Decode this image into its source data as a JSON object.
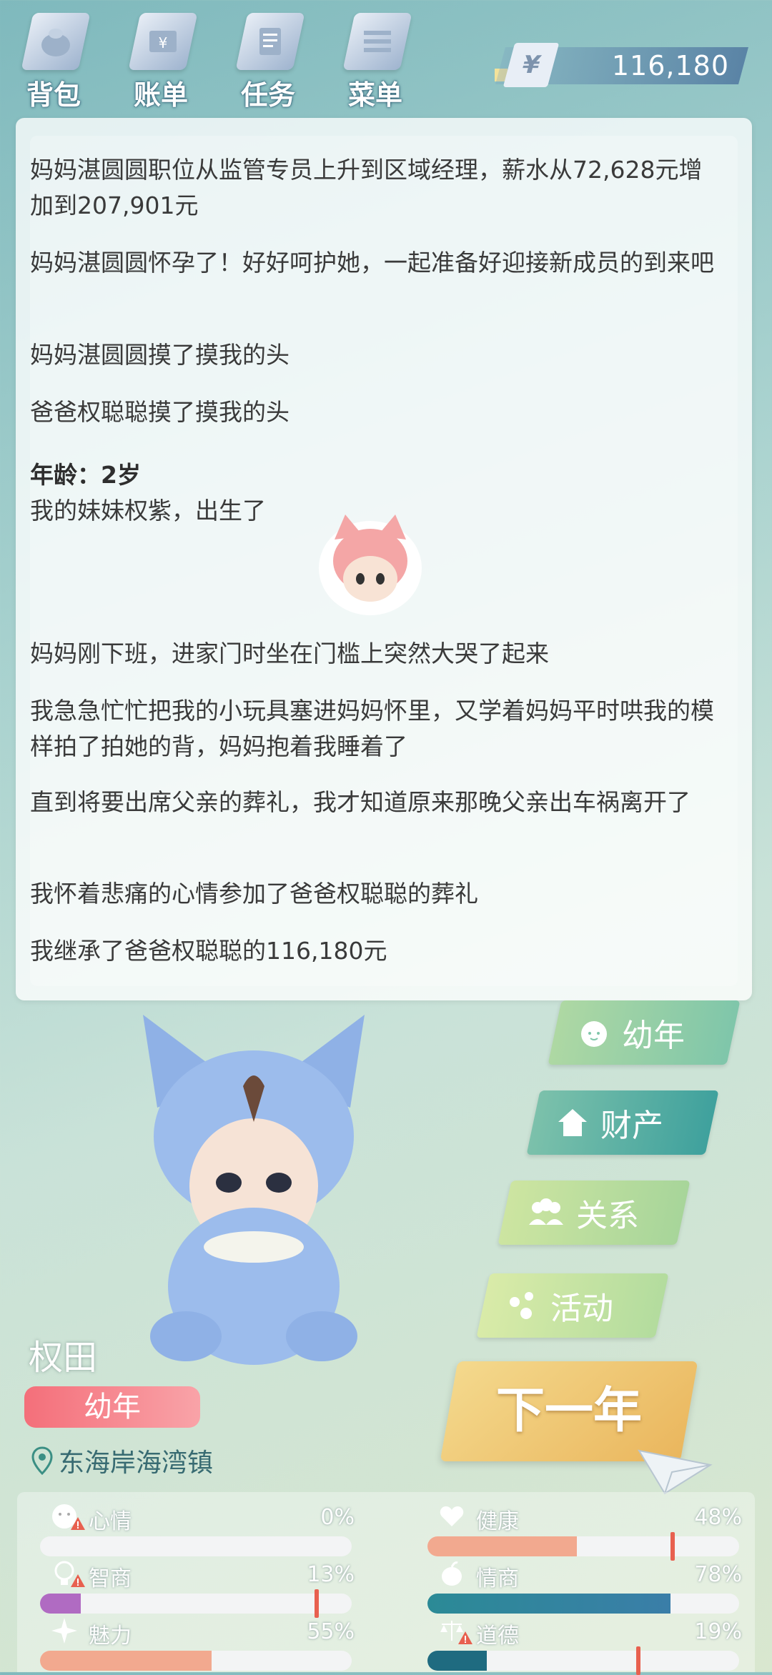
{
  "top_menu": [
    {
      "label": "背包",
      "icon": "bag-icon"
    },
    {
      "label": "账单",
      "icon": "bill-icon"
    },
    {
      "label": "任务",
      "icon": "task-icon"
    },
    {
      "label": "菜单",
      "icon": "menu-icon"
    }
  ],
  "money": {
    "symbol": "¥",
    "amount": "116,180"
  },
  "story": {
    "paragraphs_before": [
      "妈妈湛圆圆职位从监管专员上升到区域经理，薪水从72,628元增加到207,901元",
      "妈妈湛圆圆怀孕了！好好呵护她，一起准备好迎接新成员的到来吧",
      "妈妈湛圆圆摸了摸我的头",
      "爸爸权聪聪摸了摸我的头"
    ],
    "age_heading": "年龄：2岁",
    "sister_line": "我的妹妹权紫，出生了",
    "paragraphs_after": [
      "妈妈刚下班，进家门时坐在门槛上突然大哭了起来",
      "我急急忙忙把我的小玩具塞进妈妈怀里，又学着妈妈平时哄我的模样拍了拍她的背，妈妈抱着我睡着了",
      "直到将要出席父亲的葬礼，我才知道原来那晚父亲出车祸离开了",
      "我怀着悲痛的心情参加了爸爸权聪聪的葬礼",
      "我继承了爸爸权聪聪的116,180元"
    ]
  },
  "side_menu": {
    "stage": "幼年",
    "property": "财产",
    "relations": "关系",
    "activities": "活动"
  },
  "next_year": "下一年",
  "character": {
    "name": "权田",
    "stage": "幼年",
    "location": "东海岸海湾镇"
  },
  "stats": [
    {
      "name": "心情",
      "value": "0%",
      "fill": 0.0,
      "warn": true,
      "icon": "mood-face-icon"
    },
    {
      "name": "健康",
      "value": "48%",
      "fill": 0.48,
      "warn": false,
      "icon": "heart-icon"
    },
    {
      "name": "智商",
      "value": "13%",
      "fill": 0.13,
      "warn": true,
      "icon": "lightbulb-icon"
    },
    {
      "name": "情商",
      "value": "78%",
      "fill": 0.78,
      "warn": false,
      "icon": "apple-icon"
    },
    {
      "name": "魅力",
      "value": "55%",
      "fill": 0.55,
      "warn": false,
      "icon": "sparkle-icon"
    },
    {
      "name": "道德",
      "value": "19%",
      "fill": 0.19,
      "warn": true,
      "icon": "scales-icon"
    }
  ],
  "colors": {
    "accent_teal": "#2f8f99",
    "stage_pink": "#f46f7a",
    "next_gold": "#eab65d",
    "stat_pink": "#f2a98f",
    "stat_purple": "#b06bc2",
    "stat_teal": "#2b8a96"
  }
}
